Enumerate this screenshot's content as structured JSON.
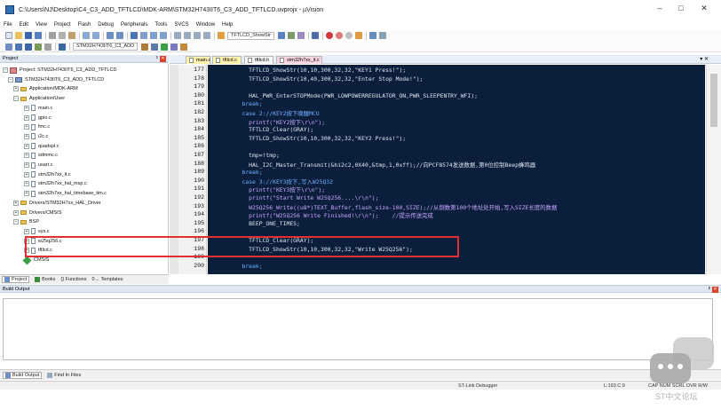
{
  "window": {
    "title": "C:\\Users\\NJ\\Desktop\\C4_C3_ADD_TFTLCD\\MDK-ARM\\STM32H743IIT6_C3_ADD_TFTLCD.uvprojx - µVision",
    "minimize": "–",
    "maximize": "□",
    "close": "✕"
  },
  "menu": [
    "File",
    "Edit",
    "View",
    "Project",
    "Flash",
    "Debug",
    "Peripherals",
    "Tools",
    "SVCS",
    "Window",
    "Help"
  ],
  "toolbar": {
    "function_combo": "TFTLCD_ShowStr",
    "target_combo": "STM32H743IIT6_C3_ADD"
  },
  "project_panel": {
    "title": "Project",
    "pin": "ᵖ",
    "close": "✕",
    "tree": [
      {
        "label": "Project: STM32H743IIT6_C3_ADD_TFTLCD",
        "type": "project",
        "exp": "−"
      },
      {
        "label": "STM32H743IIT6_C3_ADD_TFTLCD",
        "type": "target",
        "exp": "−"
      },
      {
        "label": "Application/MDK-ARM",
        "type": "folder",
        "exp": "+"
      },
      {
        "label": "Application/User",
        "type": "folder",
        "exp": "−"
      },
      {
        "label": "main.c",
        "type": "file",
        "exp": "+"
      },
      {
        "label": "gpio.c",
        "type": "file",
        "exp": "+"
      },
      {
        "label": "fmc.c",
        "type": "file",
        "exp": "+"
      },
      {
        "label": "i2c.c",
        "type": "file",
        "exp": "+"
      },
      {
        "label": "quadspi.c",
        "type": "file",
        "exp": "+"
      },
      {
        "label": "sdmmc.c",
        "type": "file",
        "exp": "+"
      },
      {
        "label": "usart.c",
        "type": "file",
        "exp": "+"
      },
      {
        "label": "stm32h7xx_it.c",
        "type": "file",
        "exp": "+"
      },
      {
        "label": "stm32h7xx_hal_msp.c",
        "type": "file",
        "exp": "+"
      },
      {
        "label": "stm32h7xx_hal_timebase_tim.c",
        "type": "file",
        "exp": "+"
      },
      {
        "label": "Drivers/STM32H7xx_HAL_Driver",
        "type": "folder",
        "exp": "+"
      },
      {
        "label": "Drivers/CMSIS",
        "type": "folder",
        "exp": "+"
      },
      {
        "label": "BSP",
        "type": "folder",
        "exp": "−"
      },
      {
        "label": "sys.c",
        "type": "file",
        "exp": "+"
      },
      {
        "label": "w25q256.c",
        "type": "file",
        "exp": "+"
      },
      {
        "label": "tftlcd.c",
        "type": "file",
        "exp": "+"
      },
      {
        "label": "CMSIS",
        "type": "cmsis",
        "exp": ""
      }
    ],
    "tabs": [
      "Project",
      "Books",
      "{} Functions",
      "0→ Templates"
    ]
  },
  "editor": {
    "tabs": [
      {
        "label": "main.c",
        "bg": "#fff3b0"
      },
      {
        "label": "tftlcd.c",
        "bg": "#fff3b0"
      },
      {
        "label": "tftlcd.h",
        "bg": "#f5f5f5"
      },
      {
        "label": "stm32h7xx_it.c",
        "bg": "#f8d6e0"
      }
    ],
    "pin": "▾ ✕",
    "lines": [
      {
        "n": "177",
        "code": "            TFTLCD_ShowStr(10,10,300,32,32,\"KEY1 Press!\");"
      },
      {
        "n": "178",
        "code": "            TFTLCD_ShowStr(10,40,300,32,32,\"Enter Stop Mode!\");"
      },
      {
        "n": "179",
        "code": ""
      },
      {
        "n": "180",
        "code": "            HAL_PWR_EnterSTOPMode(PWR_LOWPOWERREGULATOR_ON,PWR_SLEEPENTRY_WFI);"
      },
      {
        "n": "181",
        "code": "          break;"
      },
      {
        "n": "182",
        "code": "          case 2://KEY2按下唤醒MCU"
      },
      {
        "n": "183",
        "code": "            printf(\"KEY2按下\\r\\n\");"
      },
      {
        "n": "184",
        "code": "            TFTLCD_Clear(GRAY);"
      },
      {
        "n": "185",
        "code": "            TFTLCD_ShowStr(10,10,300,32,32,\"KEY2 Press!\");"
      },
      {
        "n": "186",
        "code": ""
      },
      {
        "n": "187",
        "code": "            tmp=!tmp;"
      },
      {
        "n": "188",
        "code": "            HAL_I2C_Master_Transmit(&hi2c2,0X40,&tmp,1,0xff);//向PCF8574发送数据,第0位控制Beep蜂鸣器"
      },
      {
        "n": "189",
        "code": "          break;"
      },
      {
        "n": "190",
        "code": "          case 3://KEY3按下,写入W25Q32"
      },
      {
        "n": "191",
        "code": "            printf(\"KEY3按下\\r\\n\");"
      },
      {
        "n": "192",
        "code": "            printf(\"Start Write W25Q256....\\r\\n\");"
      },
      {
        "n": "193",
        "code": "            W25Q256_Write((u8*)TEXT_Buffer,flash_size-100,SIZE);//从倒数第100个地址处开始,写入SIZE长度的数据"
      },
      {
        "n": "194",
        "code": "            printf(\"W25Q256 Write Finished!\\r\\n\");    //提示传送完成"
      },
      {
        "n": "195",
        "code": "            BEEP_ONE_TIMES;"
      },
      {
        "n": "196",
        "code": ""
      },
      {
        "n": "197",
        "code": "            TFTLCD_Clear(GRAY);"
      },
      {
        "n": "198",
        "code": "            TFTLCD_ShowStr(10,10,300,32,32,\"Write W25Q256\");"
      },
      {
        "n": "199",
        "code": ""
      },
      {
        "n": "200",
        "code": "          break;"
      }
    ]
  },
  "build_output": {
    "title": "Build Output",
    "pin": "ᵖ",
    "close": "✕",
    "tabs": [
      "Build Output",
      "Find In Files"
    ]
  },
  "statusbar": {
    "debugger": "ST-Link Debugger",
    "position": "L:193 C:9",
    "caps": "CAP NUM SCRL OVR R/W"
  },
  "watermark": {
    "text": "ST中文论坛"
  }
}
